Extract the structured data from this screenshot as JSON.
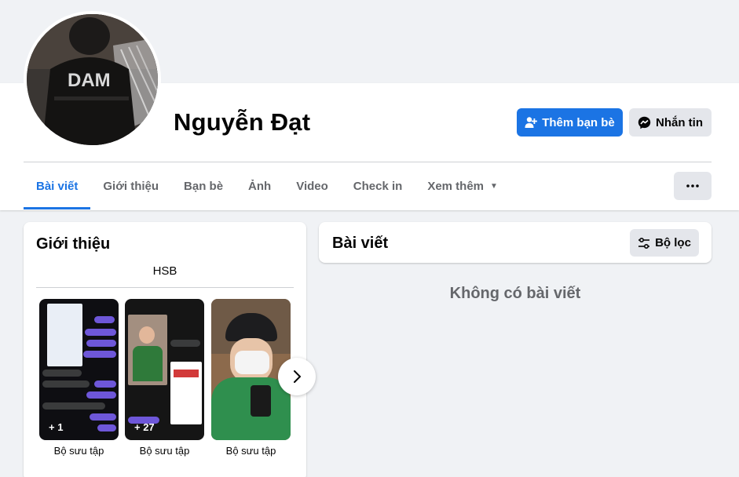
{
  "profile": {
    "name": "Nguyễn Đạt"
  },
  "actions": {
    "add_friend_label": "Thêm bạn bè",
    "message_label": "Nhắn tin",
    "more_label": "···"
  },
  "tabs": [
    {
      "label": "Bài viết",
      "active": true
    },
    {
      "label": "Giới thiệu",
      "active": false
    },
    {
      "label": "Bạn bè",
      "active": false
    },
    {
      "label": "Ảnh",
      "active": false
    },
    {
      "label": "Video",
      "active": false
    },
    {
      "label": "Check in",
      "active": false
    },
    {
      "label": "Xem thêm",
      "active": false
    }
  ],
  "intro": {
    "title": "Giới thiệu",
    "bio": "HSB",
    "collections": [
      {
        "count": "+ 1",
        "label": "Bộ sưu tập"
      },
      {
        "count": "+ 27",
        "label": "Bộ sưu tập"
      },
      {
        "count": "",
        "label": "Bộ sưu tập"
      }
    ]
  },
  "posts": {
    "title": "Bài viết",
    "filter_label": "Bộ lọc",
    "empty_text": "Không có bài viết"
  },
  "colors": {
    "accent": "#1b74e4",
    "secondary_button": "#e4e6eb",
    "muted_text": "#65676b",
    "background": "#f0f2f5"
  },
  "icons": {
    "add_friend": "person-plus-icon",
    "message": "messenger-icon",
    "more": "more-horizontal-icon",
    "filter": "filter-sliders-icon",
    "next": "chevron-right-icon",
    "dropdown": "caret-down-icon"
  }
}
